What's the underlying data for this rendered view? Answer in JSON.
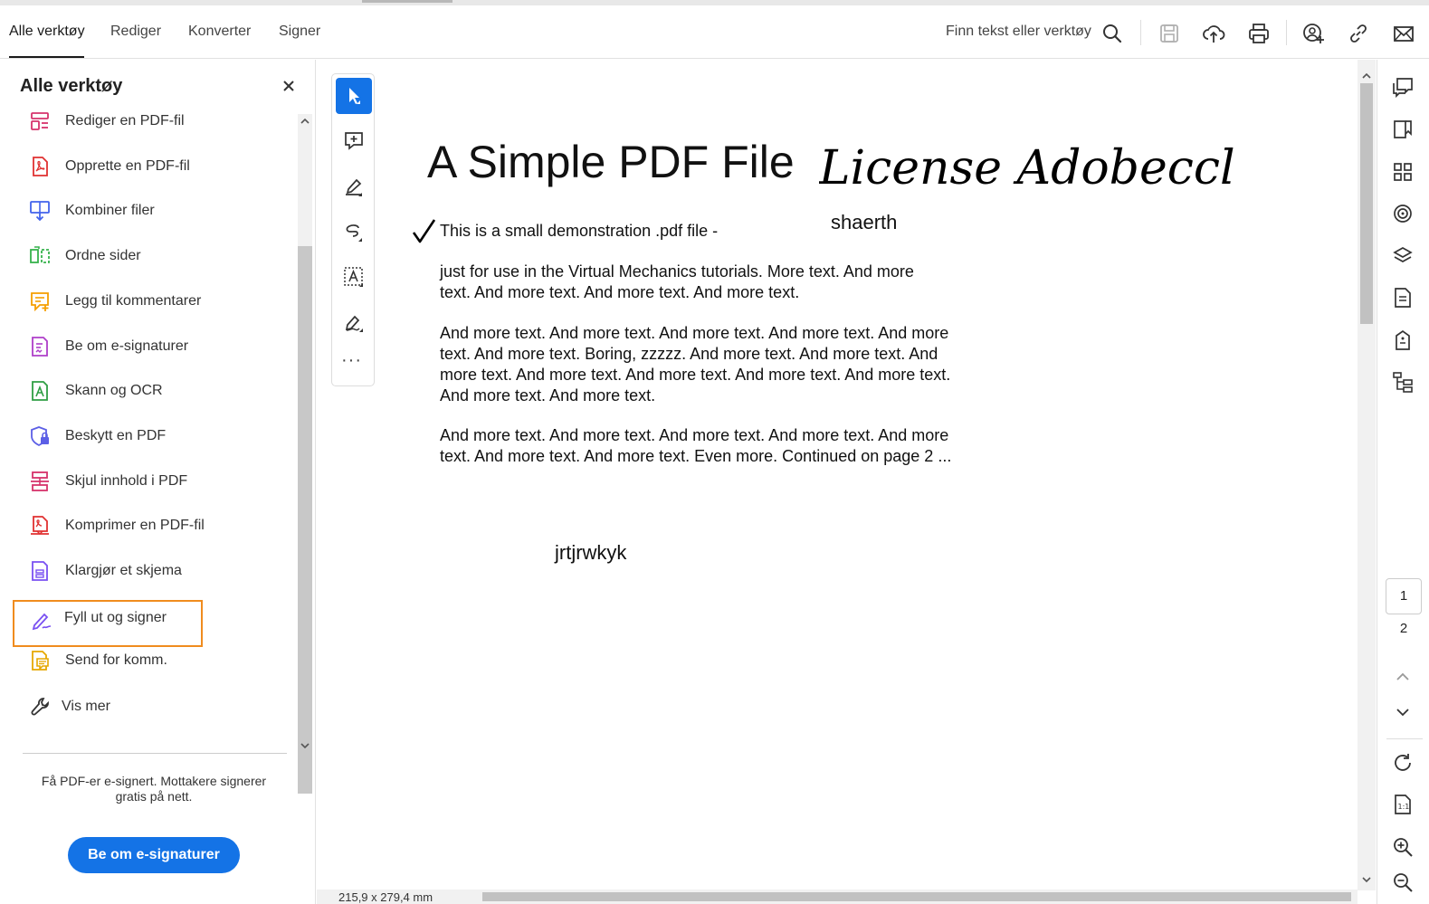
{
  "menubar": {
    "tabs": [
      {
        "label": "Alle verktøy",
        "active": true
      },
      {
        "label": "Rediger"
      },
      {
        "label": "Konverter"
      },
      {
        "label": "Signer"
      }
    ],
    "find_label": "Finn tekst eller verktøy",
    "icons": [
      "search-icon",
      "save-icon",
      "upload-cloud-icon",
      "print-icon",
      "share-user-icon",
      "link-icon",
      "mail-icon"
    ]
  },
  "left_panel": {
    "title": "Alle verktøy",
    "tools": [
      {
        "label": "Rediger en PDF-fil",
        "icon": "edit-pdf-icon",
        "color": "#d6336c"
      },
      {
        "label": "Opprette en PDF-fil",
        "icon": "create-pdf-icon",
        "color": "#e03131"
      },
      {
        "label": "Kombiner filer",
        "icon": "combine-files-icon",
        "color": "#4263eb"
      },
      {
        "label": "Ordne sider",
        "icon": "organize-pages-icon",
        "color": "#37b24d"
      },
      {
        "label": "Legg til kommentarer",
        "icon": "add-comment-icon",
        "color": "#f59f00"
      },
      {
        "label": "Be om e-signaturer",
        "icon": "request-esign-icon",
        "color": "#ae3ec9"
      },
      {
        "label": "Skann og OCR",
        "icon": "scan-ocr-icon",
        "color": "#2f9e44"
      },
      {
        "label": "Beskytt en PDF",
        "icon": "protect-pdf-icon",
        "color": "#5c5fe6"
      },
      {
        "label": "Skjul innhold i PDF",
        "icon": "redact-icon",
        "color": "#d6336c"
      },
      {
        "label": "Komprimer en PDF-fil",
        "icon": "compress-pdf-icon",
        "color": "#e03131"
      },
      {
        "label": "Klargjør et skjema",
        "icon": "prepare-form-icon",
        "color": "#7950f2"
      },
      {
        "label": "Fyll ut og signer",
        "icon": "fill-sign-icon",
        "color": "#7950f2",
        "highlighted": true
      },
      {
        "label": "Send for komm.",
        "icon": "send-comment-icon",
        "color": "#e6a800"
      }
    ],
    "more_label": "Vis mer",
    "promo_line1": "Få PDF-er e-signert. Mottakere signerer",
    "promo_line2": "gratis på nett.",
    "promo_button": "Be om e-signaturer"
  },
  "document": {
    "title": "A Simple PDF File",
    "signature_text": "License Adobeccl",
    "annotation_1": "shaerth",
    "annotation_2": "jrtjrwkyk",
    "line_1": "This is a small demonstration .pdf file -",
    "para_1": [
      "just for use in the Virtual Mechanics tutorials. More text. And more",
      "text. And more text. And more text. And more text."
    ],
    "para_2": [
      "And more text. And more text. And more text. And more text. And more",
      "text. And more text. Boring, zzzzz. And more text. And more text. And",
      "more text. And more text. And more text. And more text. And more text.",
      "And more text. And more text."
    ],
    "para_3": [
      "And more text. And more text. And more text. And more text. And more",
      "text. And more text. And more text. Even more. Continued on page 2 ..."
    ],
    "page_size": "215,9 x 279,4 mm"
  },
  "pagination": {
    "current": "1",
    "total": "2"
  },
  "colors": {
    "accent": "#1473e6",
    "highlight": "#f08c1e"
  }
}
